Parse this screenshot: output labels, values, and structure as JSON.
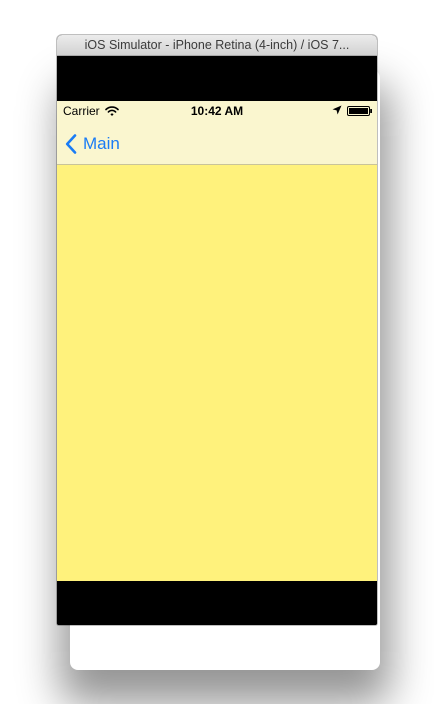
{
  "window": {
    "title": "iOS Simulator - iPhone Retina (4-inch) / iOS 7..."
  },
  "status_bar": {
    "carrier": "Carrier",
    "time": "10:42 AM",
    "icons": [
      "wifi-icon",
      "location-arrow-icon",
      "battery-icon"
    ]
  },
  "navigation": {
    "back_label": "Main",
    "back_icon": "chevron-left-icon"
  },
  "colors": {
    "screen_background": "#fff27c",
    "navbar_background": "#faf6cf",
    "tint": "#1a7cf5"
  }
}
